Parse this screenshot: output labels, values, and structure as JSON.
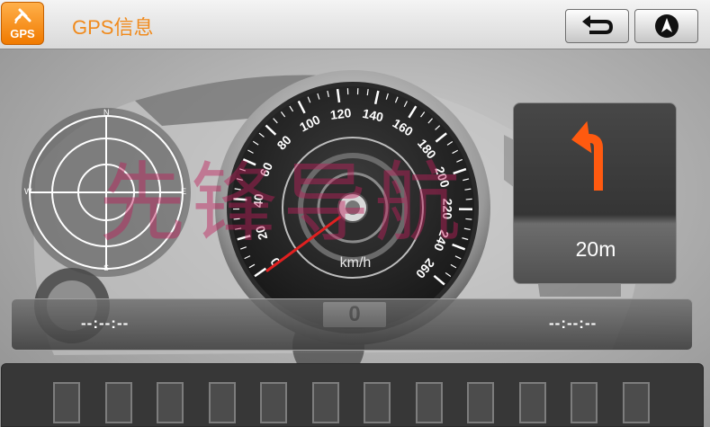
{
  "header": {
    "logo_text": "GPS",
    "title": "GPS信息",
    "back_button_icon": "back-arrow-icon",
    "navigate_button_icon": "navigation-arrow-icon"
  },
  "compass": {
    "north": "N",
    "south": "S",
    "east": "E",
    "west": "W"
  },
  "speedometer": {
    "ticks": [
      "0",
      "20",
      "40",
      "60",
      "80",
      "100",
      "120",
      "140",
      "160",
      "180",
      "200",
      "220",
      "240",
      "260"
    ],
    "unit": "km/h",
    "speed": "0"
  },
  "turn": {
    "distance": "20m",
    "icon": "turn-left-arrow-icon",
    "arrow_color": "#ff5a10"
  },
  "times": {
    "left": "--:--:--",
    "right": "--:--:--"
  },
  "satellites": {
    "bar_count": 12
  },
  "watermark": "先锋导航",
  "colors": {
    "accent": "#f08a1c",
    "watermark": "#be1e5a"
  }
}
